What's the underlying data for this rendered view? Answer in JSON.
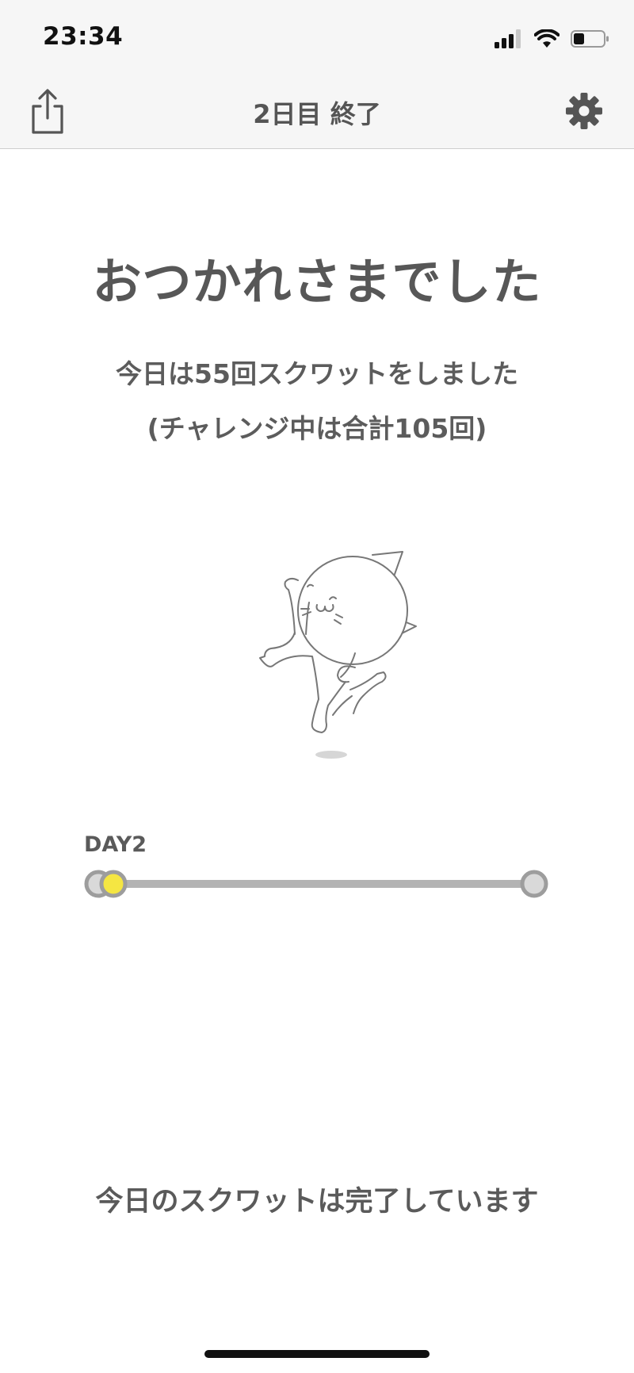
{
  "status_bar": {
    "time": "23:34",
    "icons": [
      "signal-icon",
      "wifi-icon",
      "battery-icon"
    ]
  },
  "nav": {
    "title": "2日目 終了",
    "left_icon": "share-icon",
    "right_icon": "gear-icon"
  },
  "main": {
    "headline": "おつかれさまでした",
    "summary_line1": "今日は55回スクワットをしました",
    "summary_line2": "(チャレンジ中は合計105回)",
    "illustration": "dancing-cat"
  },
  "progress": {
    "day_label": "DAY2",
    "current_day": 2,
    "total_days": 30,
    "accent_color": "#f5e642",
    "track_color": "#b3b3b3"
  },
  "footer": {
    "message": "今日のスクワットは完了しています"
  },
  "colors": {
    "text": "#5a5a5a",
    "bar_background": "#f6f6f6"
  }
}
